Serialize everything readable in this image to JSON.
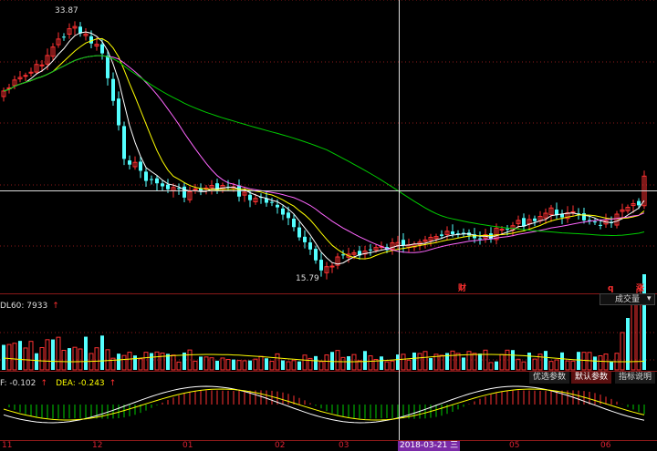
{
  "price_chart": {
    "high_label": "33.87",
    "low_label": "15.79",
    "markers": [
      {
        "text": "财",
        "color": "#ff3030"
      },
      {
        "text": "q",
        "color": "#ff3030"
      },
      {
        "text": "涨",
        "color": "#ff3030"
      }
    ]
  },
  "volume_panel": {
    "indicator_label": "DL60: 7933",
    "selector_value": "成交量",
    "dropdown_arrow": "▾",
    "up_arrow": "↑"
  },
  "macd_panel": {
    "dif_label": "F: -0.102",
    "dea_label": "DEA: -0.243",
    "buttons": [
      "优选参数",
      "默认参数",
      "指标说明"
    ]
  },
  "x_axis": {
    "ticks": [
      "11",
      "12",
      "01",
      "02",
      "03",
      "05",
      "06"
    ],
    "cursor_date": "2018-03-21 三"
  },
  "colors": {
    "up": "#ff3232",
    "down": "#54ffff",
    "ma5": "#ffffff",
    "ma10": "#ffff00",
    "ma20": "#ff66ff",
    "ma60": "#00cc00",
    "grid": "#8b1a1a",
    "background": "#000000"
  }
}
